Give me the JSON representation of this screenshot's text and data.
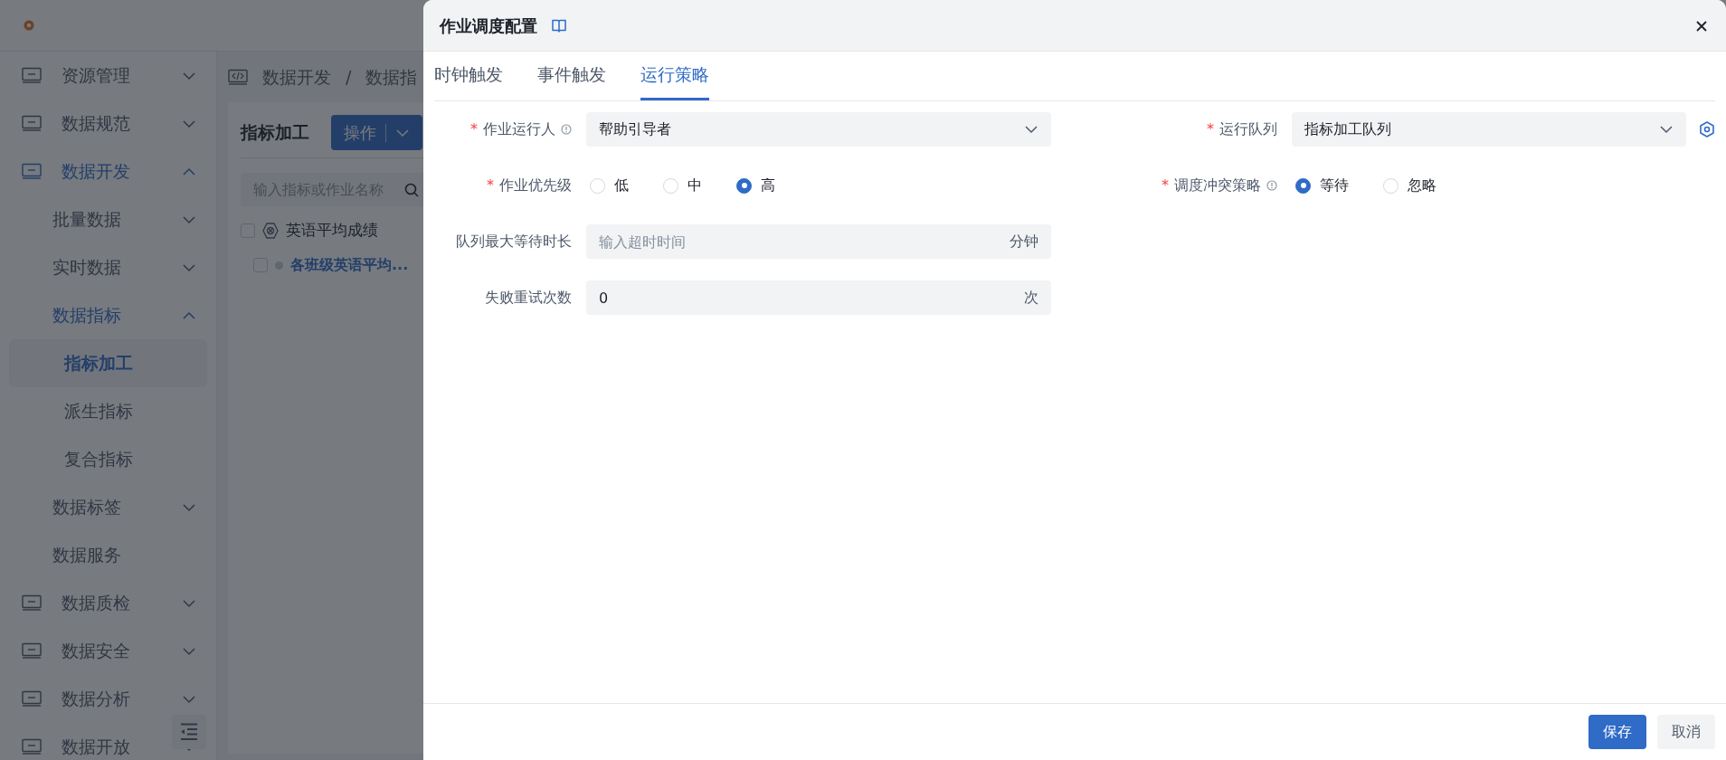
{
  "sidebar": {
    "items": [
      {
        "label": "资源管理",
        "expanded": false,
        "active": false,
        "selected": false
      },
      {
        "label": "数据规范",
        "expanded": false,
        "active": false,
        "selected": false
      },
      {
        "label": "数据开发",
        "expanded": true,
        "active": true,
        "selected": false,
        "children": [
          {
            "label": "批量数据",
            "expanded": false,
            "active": false,
            "selected": false
          },
          {
            "label": "实时数据",
            "expanded": false,
            "active": false,
            "selected": false
          },
          {
            "label": "数据指标",
            "expanded": true,
            "active": true,
            "selected": false,
            "children": [
              {
                "label": "指标加工",
                "selected": true
              },
              {
                "label": "派生指标",
                "selected": false
              },
              {
                "label": "复合指标",
                "selected": false
              }
            ]
          },
          {
            "label": "数据标签",
            "expanded": false,
            "active": false,
            "selected": false
          },
          {
            "label": "数据服务",
            "selected": false
          }
        ]
      },
      {
        "label": "数据质检",
        "expanded": false,
        "active": false,
        "selected": false
      },
      {
        "label": "数据安全",
        "expanded": false,
        "active": false,
        "selected": false
      },
      {
        "label": "数据分析",
        "expanded": false,
        "active": false,
        "selected": false
      },
      {
        "label": "数据开放",
        "expanded": false,
        "active": false,
        "selected": false
      }
    ]
  },
  "breadcrumb": {
    "items": [
      "数据开发",
      "数据指"
    ],
    "separator": "/"
  },
  "panel": {
    "title": "指标加工",
    "action_button": "操作",
    "search": {
      "placeholder": "输入指标或作业名称"
    },
    "tree": [
      {
        "label": "英语平均成绩",
        "checked": false,
        "children": [
          {
            "label": "各班级英语平均...",
            "checked": false
          }
        ]
      }
    ]
  },
  "dialog": {
    "title": "作业调度配置",
    "tabs": [
      {
        "label": "时钟触发",
        "selected": false
      },
      {
        "label": "事件触发",
        "selected": false
      },
      {
        "label": "运行策略",
        "selected": true
      }
    ],
    "rows": [
      {
        "fields": [
          {
            "kind": "select",
            "required_mark": "*",
            "label": "作业运行人",
            "info": true,
            "value": "帮助引导者"
          },
          {
            "kind": "select",
            "required_mark": "*",
            "label": "运行队列",
            "value": "指标加工队列",
            "settings": true
          }
        ]
      },
      {
        "fields": [
          {
            "kind": "radio",
            "required_mark": "*",
            "label": "作业优先级",
            "options": [
              {
                "label": "低",
                "selected": false
              },
              {
                "label": "中",
                "selected": false
              },
              {
                "label": "高",
                "selected": true
              }
            ]
          },
          {
            "kind": "radio",
            "required_mark": "*",
            "label": "调度冲突策略",
            "info": true,
            "options": [
              {
                "label": "等待",
                "selected": true
              },
              {
                "label": "忽略",
                "selected": false
              }
            ]
          }
        ]
      },
      {
        "fields": [
          {
            "kind": "input",
            "label": "队列最大等待时长",
            "placeholder": "输入超时时间",
            "suffix": "分钟"
          }
        ]
      },
      {
        "fields": [
          {
            "kind": "input",
            "label": "失败重试次数",
            "value": "0",
            "suffix": "次"
          }
        ]
      }
    ],
    "buttons": [
      {
        "label": "保存",
        "kind": "primary"
      },
      {
        "label": "取消",
        "kind": "secondary"
      }
    ]
  }
}
